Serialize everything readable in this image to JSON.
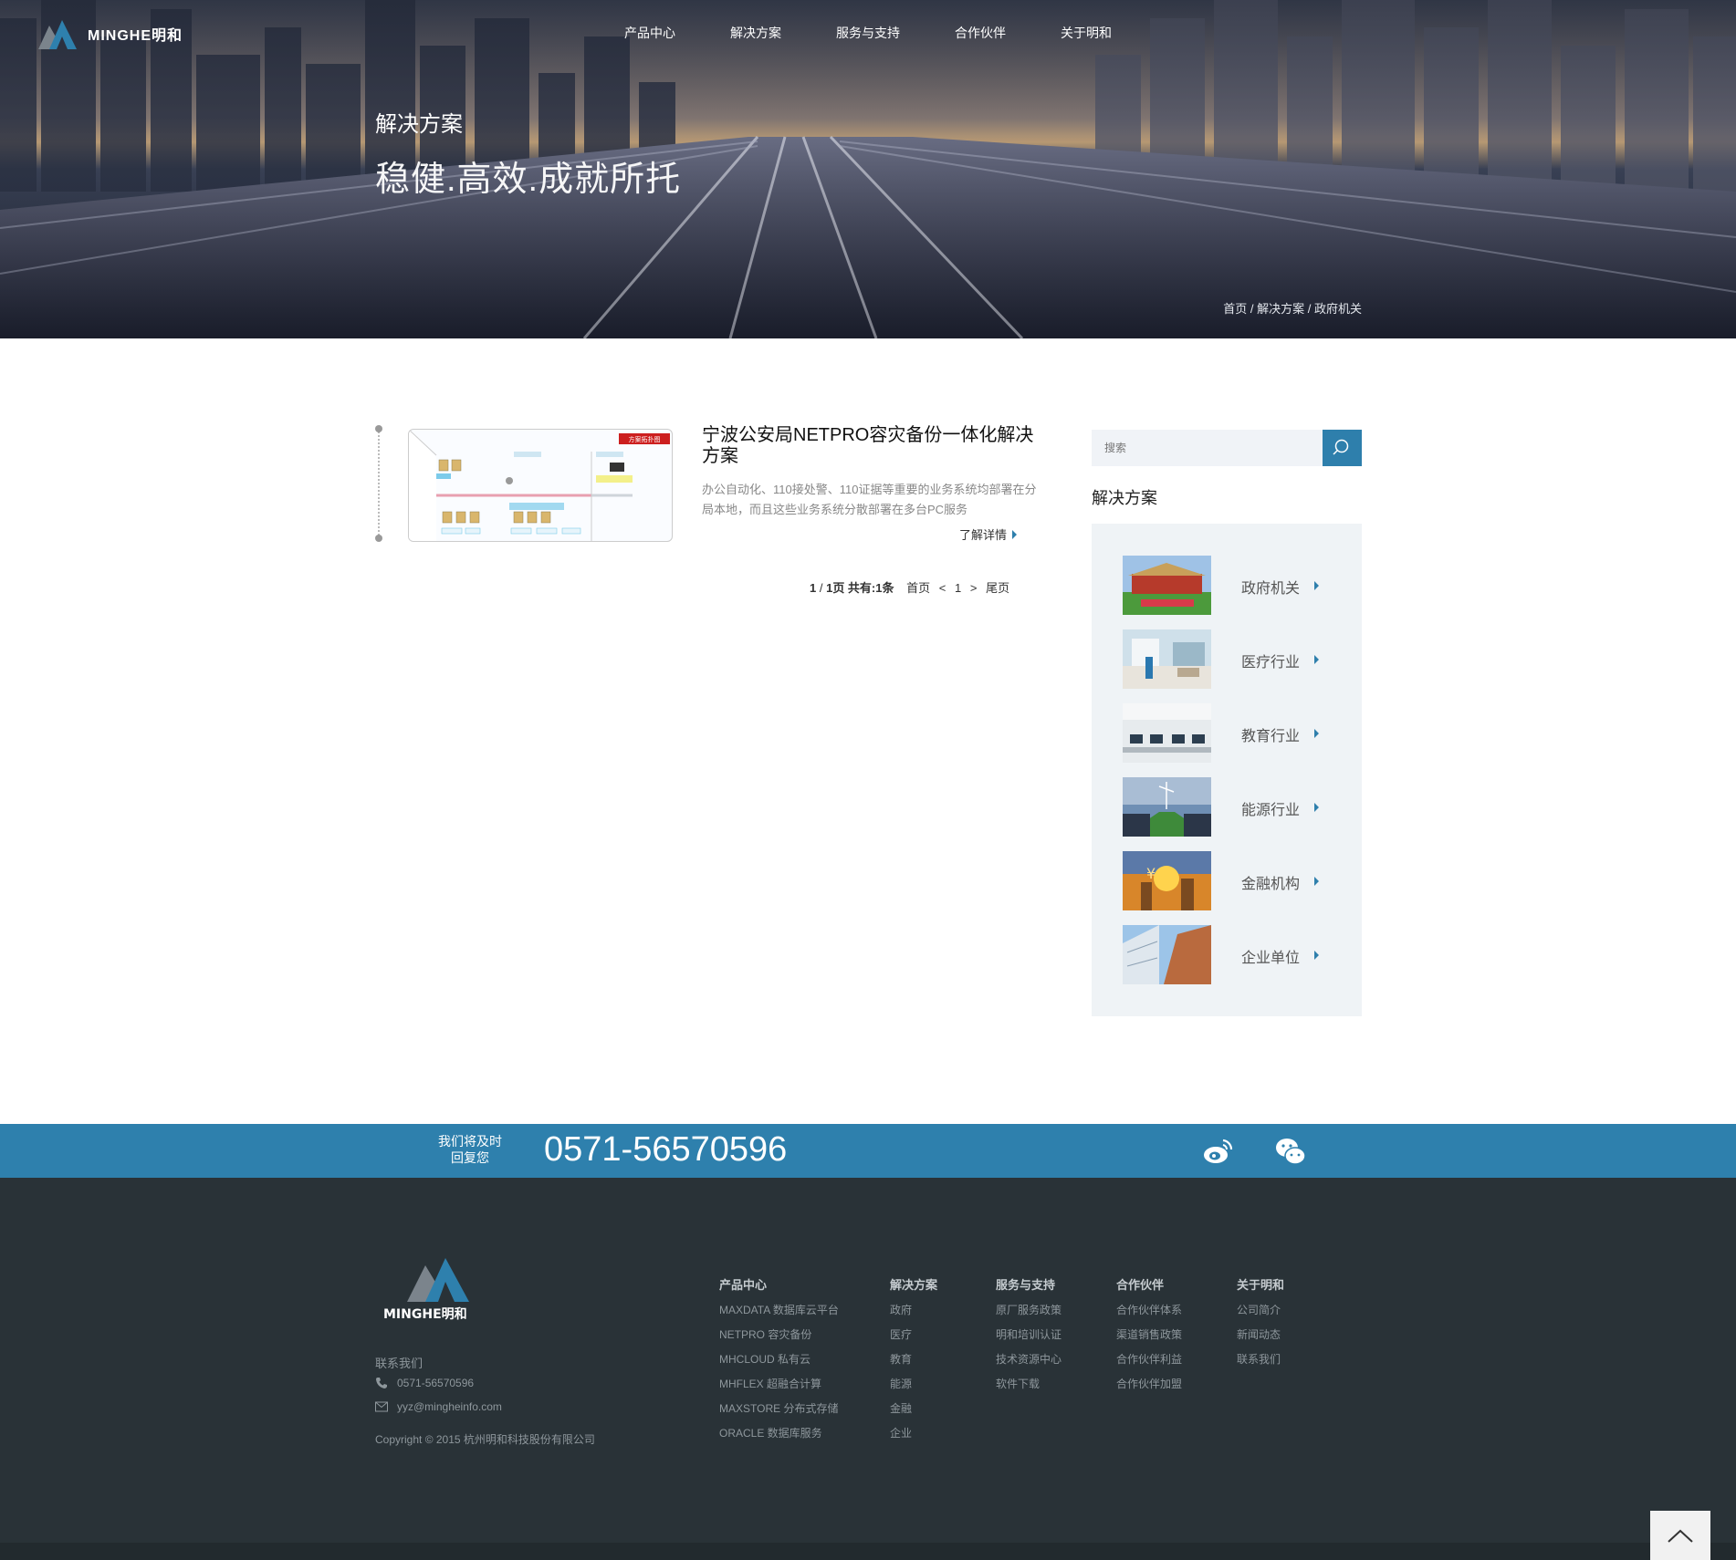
{
  "brand": {
    "logo_text": "MINGHE明和"
  },
  "nav": {
    "items": [
      "产品中心",
      "解决方案",
      "服务与支持",
      "合作伙伴",
      "关于明和"
    ]
  },
  "hero": {
    "title": "解决方案",
    "subtitle": "稳健.高效.成就所托"
  },
  "breadcrumb": {
    "home": "首页",
    "sep": " / ",
    "section": "解决方案",
    "current": "政府机关"
  },
  "article": {
    "title": "宁波公安局NETPRO容灾备份一体化解决方案",
    "desc": "办公自动化、110接处警、110证据等重要的业务系统均部署在分局本地，而且这些业务系统分散部署在多台PC服务",
    "more": "了解详情",
    "thumb_badge": "方案拓扑图"
  },
  "pager": {
    "current": "1",
    "slash": " / ",
    "total": "1",
    "page_word": "页 共有:",
    "count": "1",
    "count_word": "条",
    "first": "首页",
    "prev": "<",
    "page": "1",
    "next": ">",
    "last": "尾页"
  },
  "sidebar": {
    "search_placeholder": "搜索",
    "heading": "解决方案",
    "items": [
      {
        "label": "政府机关"
      },
      {
        "label": "医疗行业"
      },
      {
        "label": "教育行业"
      },
      {
        "label": "能源行业"
      },
      {
        "label": "金融机构"
      },
      {
        "label": "企业单位"
      }
    ]
  },
  "contact_bar": {
    "reply_line1": "我们将及时",
    "reply_line2": "回复您",
    "phone": "0571-56570596"
  },
  "footer": {
    "contact_heading": "联系我们",
    "phone": "0571-56570596",
    "email": "yyz@mingheinfo.com",
    "copyright": "Copyright © 2015 杭州明和科技股份有限公司",
    "columns": [
      {
        "title": "产品中心",
        "items": [
          "MAXDATA 数据库云平台",
          "NETPRO 容灾备份",
          "MHCLOUD 私有云",
          "MHFLEX 超融合计算",
          "MAXSTORE 分布式存储",
          "ORACLE 数据库服务"
        ]
      },
      {
        "title": "解决方案",
        "items": [
          "政府",
          "医疗",
          "教育",
          "能源",
          "金融",
          "企业"
        ]
      },
      {
        "title": "服务与支持",
        "items": [
          "原厂服务政策",
          "明和培训认证",
          "技术资源中心",
          "软件下载"
        ]
      },
      {
        "title": "合作伙伴",
        "items": [
          "合作伙伴体系",
          "渠道销售政策",
          "合作伙伴利益",
          "合作伙伴加盟"
        ]
      },
      {
        "title": "关于明和",
        "items": [
          "公司简介",
          "新闻动态",
          "联系我们"
        ]
      }
    ]
  },
  "colors": {
    "accent": "#2e80ad",
    "footer_bg": "#293237",
    "side_bg": "#eff3f6"
  }
}
